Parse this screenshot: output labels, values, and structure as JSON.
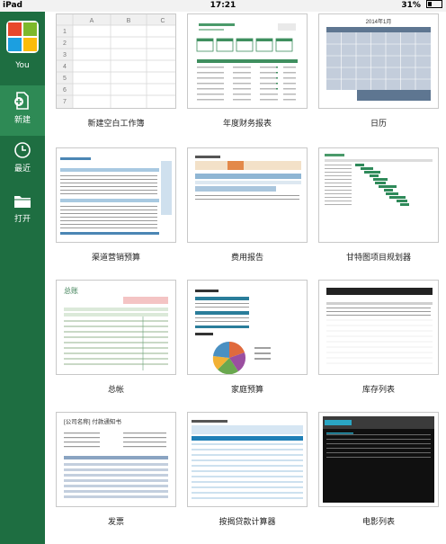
{
  "status": {
    "device": "iPad",
    "time": "17:21",
    "battery": "31%"
  },
  "sidebar": {
    "you": "You",
    "items": [
      {
        "label": "新建"
      },
      {
        "label": "最近"
      },
      {
        "label": "打开"
      }
    ]
  },
  "templates": [
    {
      "label": "新建空白工作簿",
      "cols": [
        "A",
        "B",
        "C"
      ],
      "rows": [
        "1",
        "2",
        "3",
        "4",
        "5",
        "6",
        "7"
      ]
    },
    {
      "label": "年度财务报表"
    },
    {
      "label": "日历",
      "title": "2014年1月"
    },
    {
      "label": "渠道营销预算"
    },
    {
      "label": "费用报告"
    },
    {
      "label": "甘特图项目规划器"
    },
    {
      "label": "总帐",
      "title": "总账"
    },
    {
      "label": "家庭预算"
    },
    {
      "label": "库存列表"
    },
    {
      "label": "发票",
      "title": "[公司名称] 付款通知书"
    },
    {
      "label": "按揭贷款计算器"
    },
    {
      "label": "电影列表"
    }
  ]
}
